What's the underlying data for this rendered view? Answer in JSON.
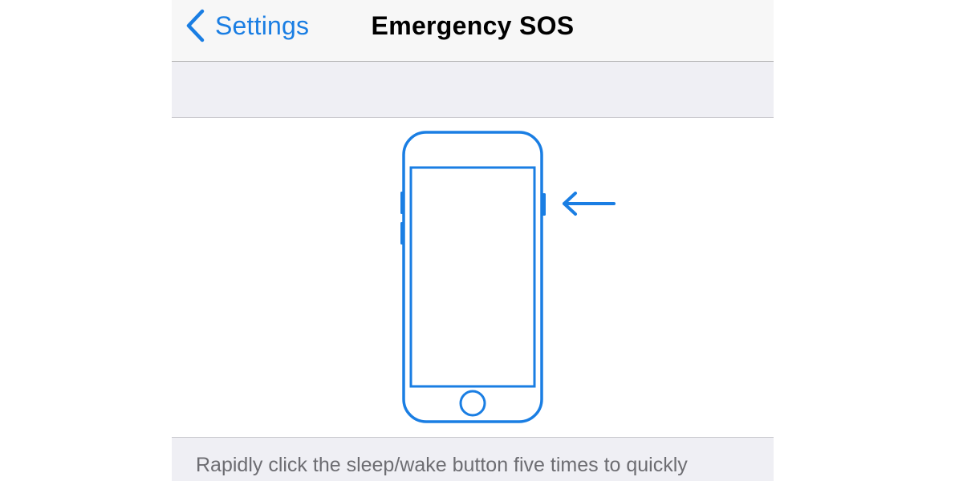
{
  "navbar": {
    "back_label": "Settings",
    "title": "Emergency SOS"
  },
  "illustration": {
    "device_icon": "iphone-outline-icon",
    "arrow_icon": "left-arrow-icon",
    "accent_color": "#1a7ee3"
  },
  "footer": {
    "description": "Rapidly click the sleep/wake button five times to quickly"
  },
  "colors": {
    "tint": "#1a7ee3",
    "navbar_bg": "#f7f7f7",
    "grouped_bg": "#efeff4",
    "footer_text": "#6d6d72"
  }
}
